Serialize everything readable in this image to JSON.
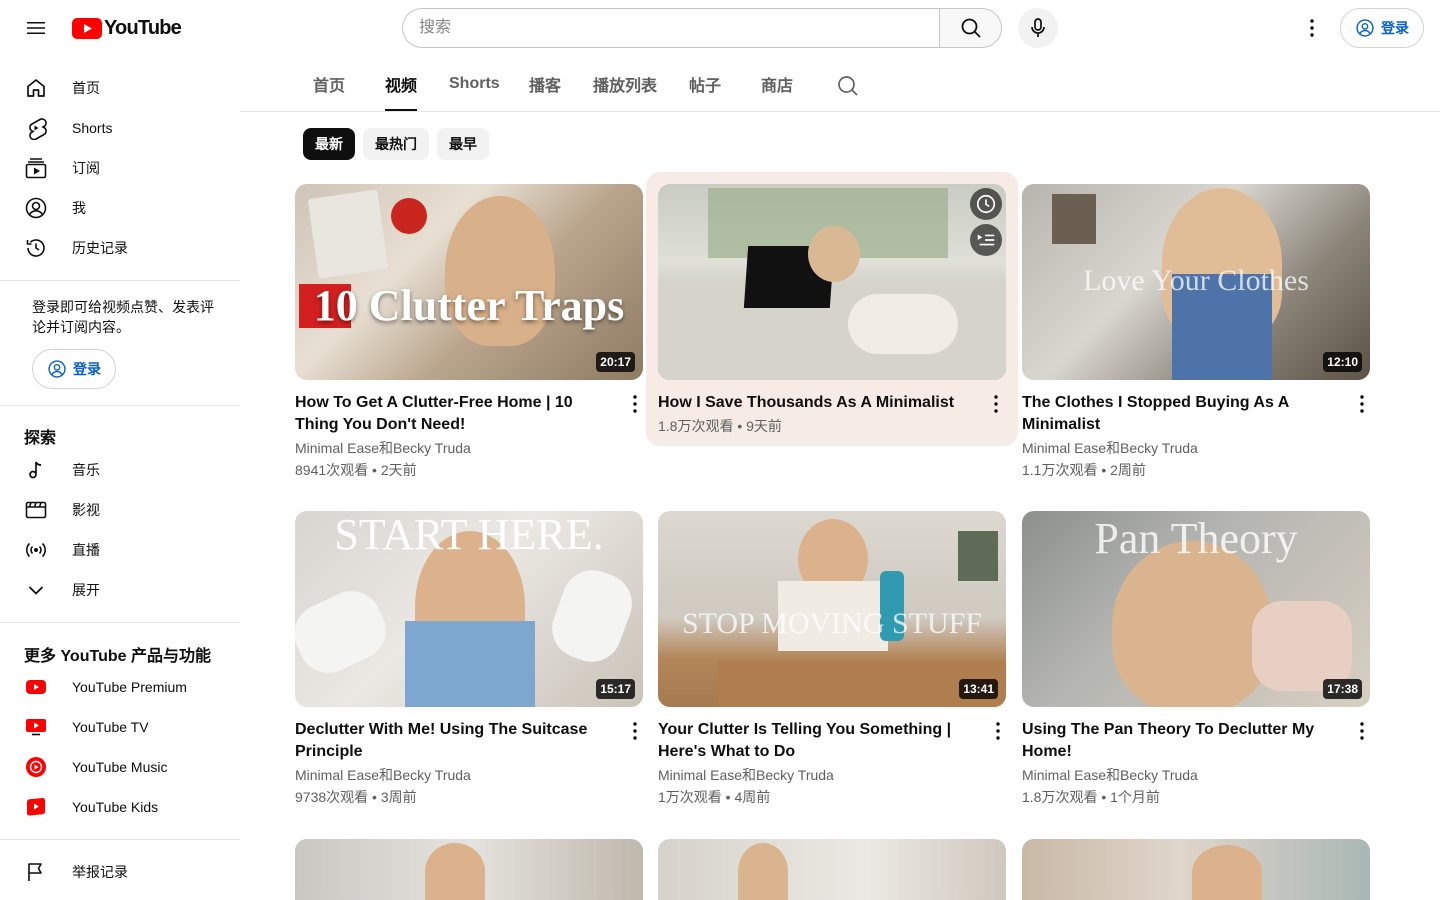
{
  "header": {
    "logo_text": "YouTube",
    "search_placeholder": "搜索",
    "signin_label": "登录"
  },
  "sidebar": {
    "main_items": [
      {
        "label": "首页",
        "icon": "home-icon"
      },
      {
        "label": "Shorts",
        "icon": "shorts-icon"
      },
      {
        "label": "订阅",
        "icon": "subscriptions-icon"
      },
      {
        "label": "我",
        "icon": "you-icon"
      },
      {
        "label": "历史记录",
        "icon": "history-icon"
      }
    ],
    "signin_prompt": "登录即可给视频点赞、发表评论并订阅内容。",
    "signin_label": "登录",
    "explore_title": "探索",
    "explore_items": [
      {
        "label": "音乐",
        "icon": "music-icon"
      },
      {
        "label": "影视",
        "icon": "movies-icon"
      },
      {
        "label": "直播",
        "icon": "live-icon"
      },
      {
        "label": "展开",
        "icon": "chevron-down-icon"
      }
    ],
    "more_title": "更多 YouTube 产品与功能",
    "more_items": [
      {
        "label": "YouTube Premium",
        "icon": "youtube-premium-icon"
      },
      {
        "label": "YouTube TV",
        "icon": "youtube-tv-icon"
      },
      {
        "label": "YouTube Music",
        "icon": "youtube-music-icon"
      },
      {
        "label": "YouTube Kids",
        "icon": "youtube-kids-icon"
      }
    ],
    "report_label": "举报记录"
  },
  "tabs": [
    "首页",
    "视频",
    "Shorts",
    "播客",
    "播放列表",
    "帖子",
    "商店"
  ],
  "active_tab": "视频",
  "chips": [
    "最新",
    "最热门",
    "最早"
  ],
  "active_chip": "最新",
  "videos": [
    {
      "title": "How To Get A Clutter-Free Home | 10 Thing You Don't Need!",
      "channel": "Minimal Ease和Becky Truda",
      "stats": "8941次观看 • 2天前",
      "duration": "20:17",
      "thumb_text": "10 Clutter Traps"
    },
    {
      "title": "How I Save Thousands As A Minimalist",
      "channel": "",
      "stats": "1.8万次观看 • 9天前",
      "duration": "",
      "thumb_text": ""
    },
    {
      "title": "The Clothes I Stopped Buying As A Minimalist",
      "channel": "Minimal Ease和Becky Truda",
      "stats": "1.1万次观看 • 2周前",
      "duration": "12:10",
      "thumb_text": "Love Your Clothes"
    },
    {
      "title": "Declutter With Me! Using The Suitcase Principle",
      "channel": "Minimal Ease和Becky Truda",
      "stats": "9738次观看 • 3周前",
      "duration": "15:17",
      "thumb_text": "START HERE."
    },
    {
      "title": "Your Clutter Is Telling You Something | Here's What to Do",
      "channel": "Minimal Ease和Becky Truda",
      "stats": "1万次观看 • 4周前",
      "duration": "13:41",
      "thumb_text": "STOP MOVING STUFF"
    },
    {
      "title": "Using The Pan Theory To Declutter My Home!",
      "channel": "Minimal Ease和Becky Truda",
      "stats": "1.8万次观看 • 1个月前",
      "duration": "17:38",
      "thumb_text": "Pan Theory"
    }
  ],
  "colors": {
    "brand_red": "#ff0000",
    "link_blue": "#065fd4",
    "hover_card": "#f7ebe6"
  }
}
